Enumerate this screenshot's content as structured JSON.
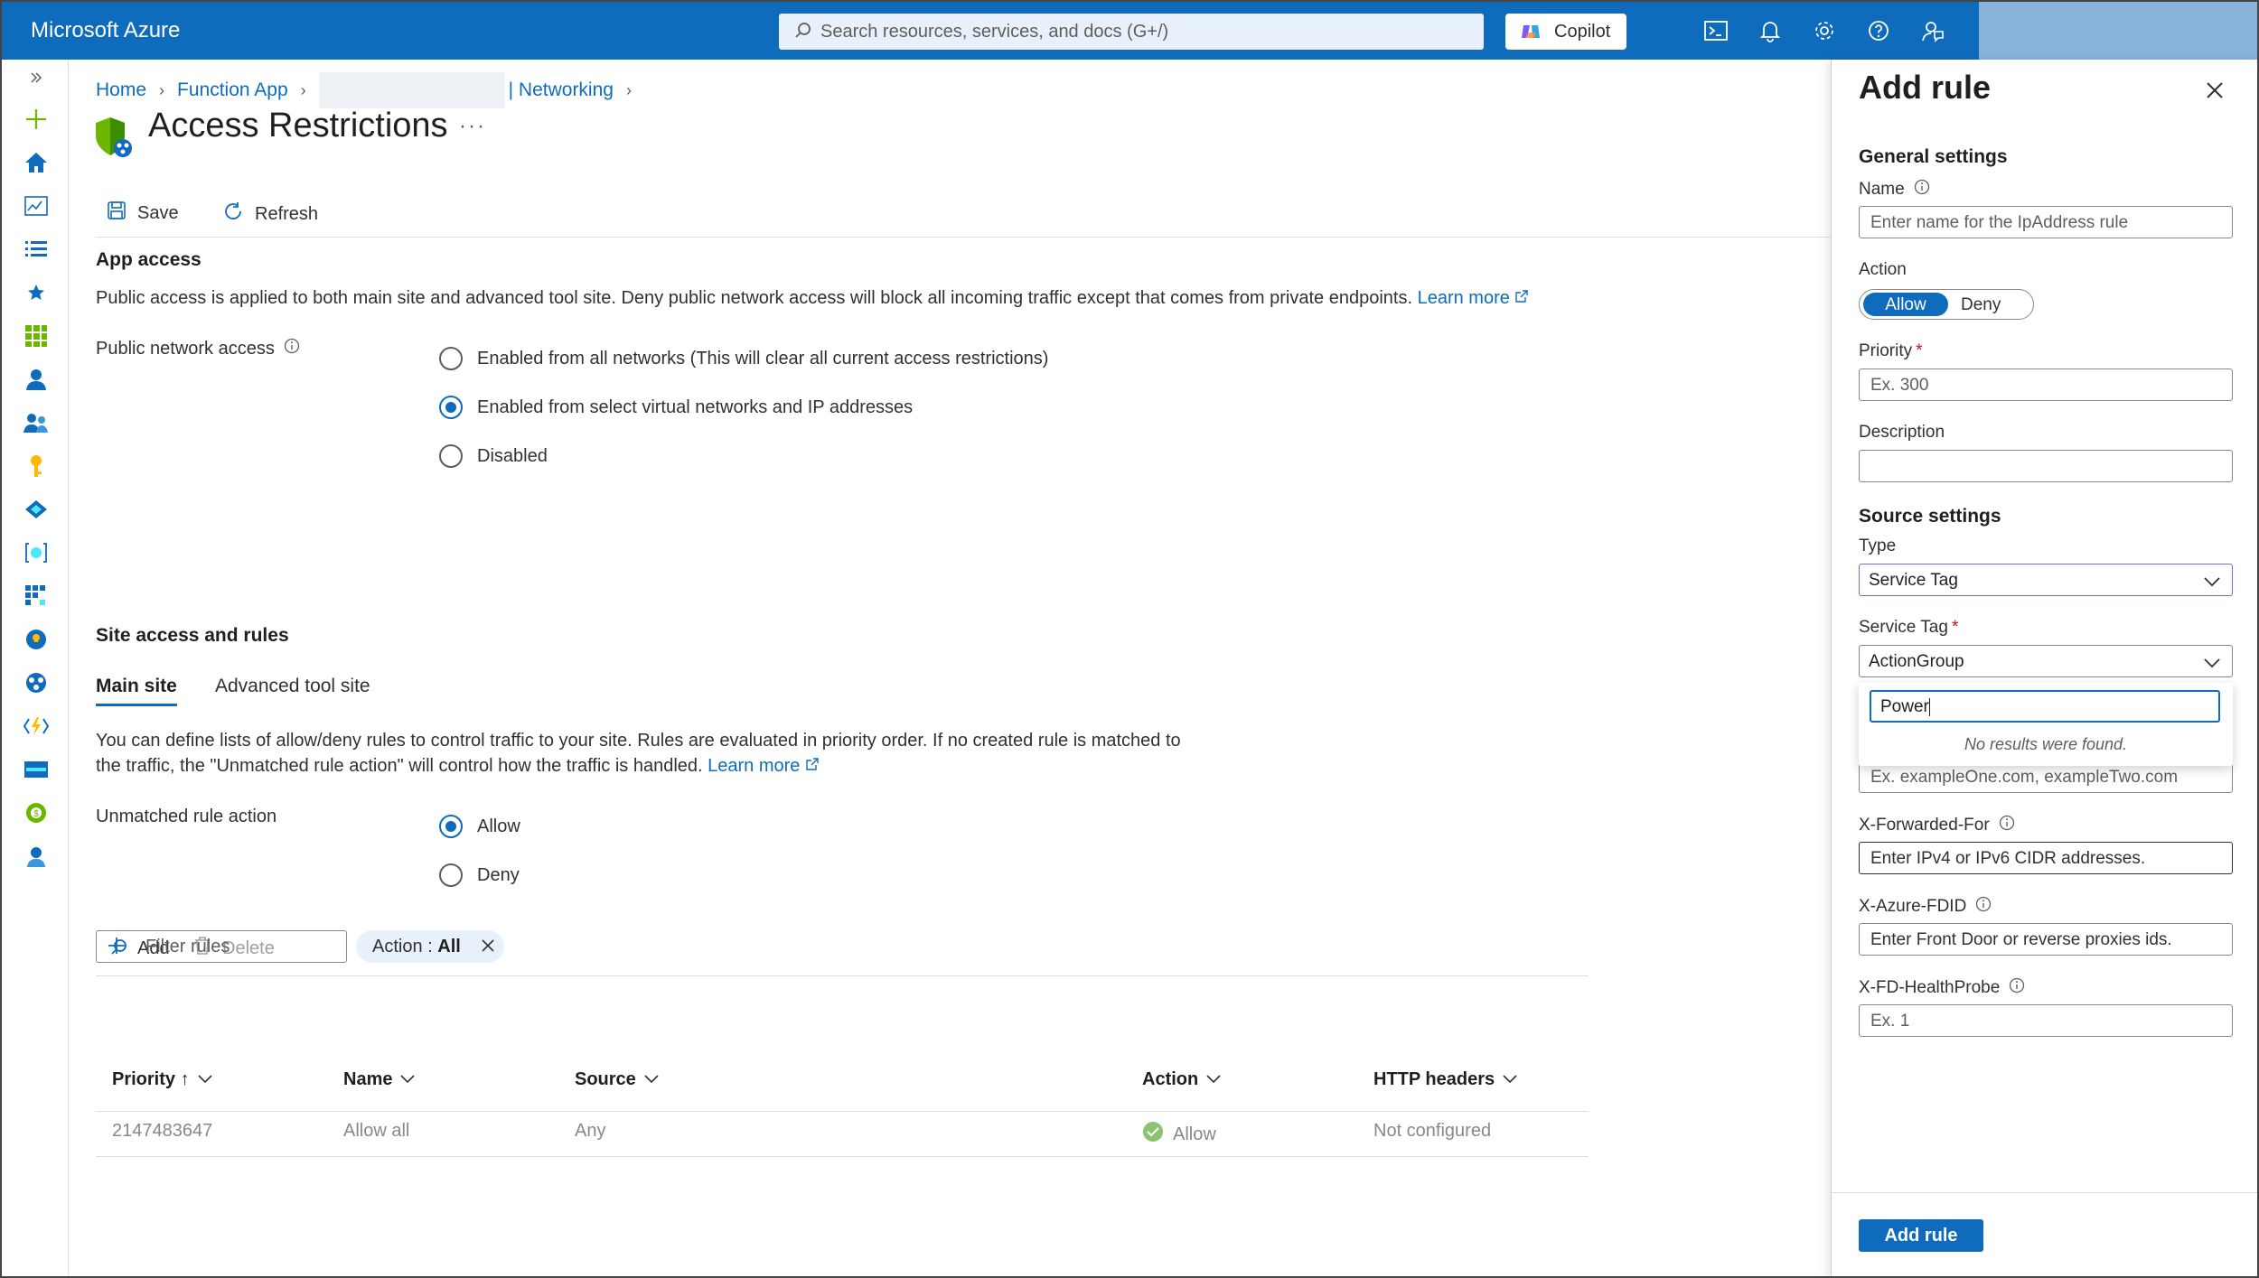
{
  "topbar": {
    "brand": "Microsoft Azure",
    "search_placeholder": "Search resources, services, and docs (G+/)",
    "copilot_label": "Copilot"
  },
  "breadcrumb": {
    "home": "Home",
    "function_app": "Function App",
    "networking": "| Networking"
  },
  "page": {
    "title": "Access Restrictions",
    "ellipsis": "···",
    "save_label": "Save",
    "refresh_label": "Refresh"
  },
  "app_access": {
    "heading": "App access",
    "description": "Public access is applied to both main site and advanced tool site. Deny public network access will block all incoming traffic except that comes from private endpoints.",
    "learn_more": "Learn more",
    "public_network_label": "Public network access",
    "options": [
      {
        "label": "Enabled from all networks (This will clear all current access restrictions)",
        "selected": false
      },
      {
        "label": "Enabled from select virtual networks and IP addresses",
        "selected": true
      },
      {
        "label": "Disabled",
        "selected": false
      }
    ]
  },
  "site_access": {
    "heading": "Site access and rules",
    "tabs": [
      "Main site",
      "Advanced tool site"
    ],
    "active_tab": "Main site",
    "description_line1": "You can define lists of allow/deny rules to control traffic to your site. Rules are evaluated in priority order. If no created rule is matched to",
    "description_line2": "the traffic, the \"Unmatched rule action\" will control how the traffic is handled.",
    "learn_more": "Learn more",
    "unmatched_label": "Unmatched rule action",
    "unmatched_options": [
      {
        "label": "Allow",
        "selected": true
      },
      {
        "label": "Deny",
        "selected": false
      }
    ],
    "add_label": "Add",
    "delete_label": "Delete",
    "filter_placeholder": "Filter rules",
    "pill_prefix": "Action : ",
    "pill_value": "All",
    "columns": [
      "Priority ↑",
      "Name",
      "Source",
      "Action",
      "HTTP headers"
    ],
    "rows": [
      {
        "priority": "2147483647",
        "name": "Allow all",
        "source": "Any",
        "action": "Allow",
        "headers": "Not configured"
      }
    ]
  },
  "panel": {
    "title": "Add rule",
    "general_heading": "General settings",
    "name_label": "Name",
    "name_placeholder": "Enter name for the IpAddress rule",
    "action_label": "Action",
    "action_allow": "Allow",
    "action_deny": "Deny",
    "priority_label": "Priority",
    "priority_placeholder": "Ex. 300",
    "description_label": "Description",
    "source_heading": "Source settings",
    "type_label": "Type",
    "type_value": "Service Tag",
    "service_tag_label": "Service Tag",
    "service_tag_value": "ActionGroup",
    "search_value": "Power",
    "no_results": "No results were found.",
    "host_placeholder": "Ex. exampleOne.com, exampleTwo.com",
    "xff_label": "X-Forwarded-For",
    "xff_placeholder": "Enter IPv4 or IPv6 CIDR addresses.",
    "fdid_label": "X-Azure-FDID",
    "fdid_placeholder": "Enter Front Door or reverse proxies ids.",
    "probe_label": "X-FD-HealthProbe",
    "probe_placeholder": "Ex. 1",
    "add_button": "Add rule"
  },
  "colors": {
    "accent": "#0f6cbd",
    "success": "#6bb700",
    "required": "#c50f1f"
  }
}
